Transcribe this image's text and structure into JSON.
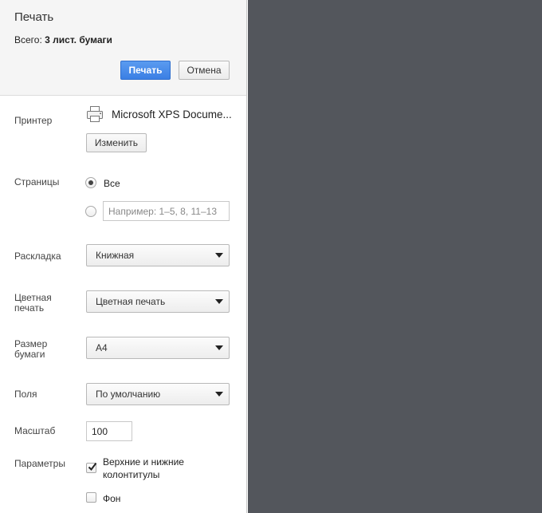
{
  "header": {
    "title": "Печать",
    "summary_prefix": "Всего:",
    "summary_value": "3 лист. бумаги",
    "print_button": "Печать",
    "cancel_button": "Отмена"
  },
  "printer": {
    "label": "Принтер",
    "icon": "printer-icon",
    "name": "Microsoft XPS Docume...",
    "change_button": "Изменить"
  },
  "pages": {
    "label": "Страницы",
    "option_all": "Все",
    "option_all_selected": true,
    "custom_placeholder": "Например: 1–5, 8, 11–13",
    "custom_value": ""
  },
  "layout": {
    "label": "Раскладка",
    "value": "Книжная"
  },
  "color": {
    "label_line1": "Цветная",
    "label_line2": "печать",
    "value": "Цветная печать"
  },
  "paper": {
    "label_line1": "Размер",
    "label_line2": "бумаги",
    "value": "A4"
  },
  "margins": {
    "label": "Поля",
    "value": "По умолчанию"
  },
  "scale": {
    "label": "Масштаб",
    "value": "100"
  },
  "options": {
    "label": "Параметры",
    "headers_footers_line1": "Верхние и нижние",
    "headers_footers_line2": "колонтитулы",
    "headers_footers_checked": true,
    "background": "Фон",
    "background_checked": false
  },
  "colors": {
    "primary_button": "#3b7fe4",
    "preview_background": "#53565c",
    "header_background": "#f5f5f5"
  }
}
